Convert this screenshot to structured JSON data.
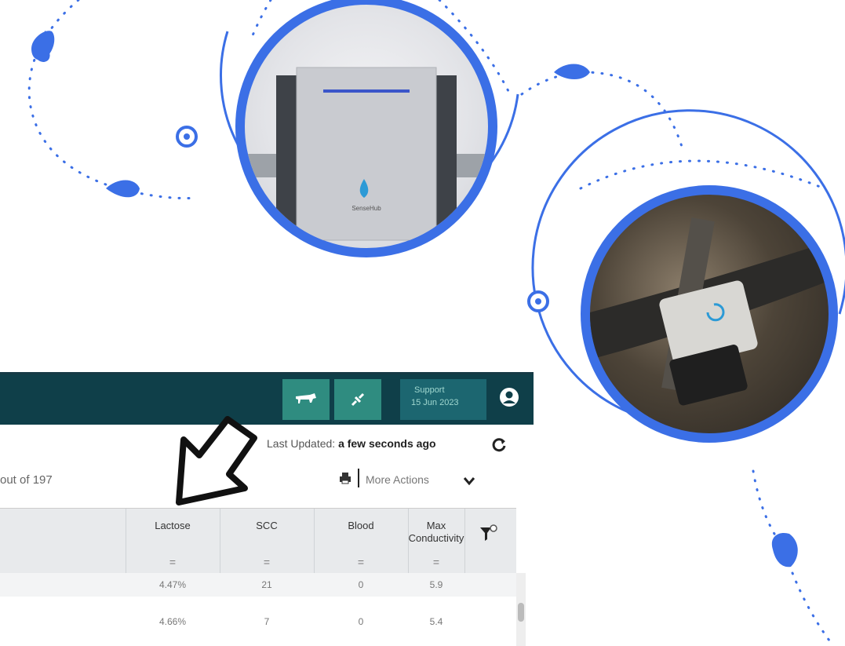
{
  "header": {
    "support_label": "Support",
    "date": "15 Jun 2023"
  },
  "status": {
    "last_updated_prefix": "Last Updated: ",
    "last_updated_value": "a few seconds ago"
  },
  "list": {
    "count_text": "out of 197",
    "more_actions": "More Actions"
  },
  "table": {
    "columns": [
      "Lactose",
      "SCC",
      "Blood",
      "Max Conductivity"
    ],
    "filter_symbol": "=",
    "rows": [
      [
        "4.47%",
        "21",
        "0",
        "5.9"
      ],
      [
        "4.66%",
        "7",
        "0",
        "5.4"
      ]
    ]
  },
  "device_labels": {
    "brand": "SenseHub",
    "brand_mark": "™"
  },
  "colors": {
    "accent": "#3b6fe6",
    "topbar": "#0f3f49",
    "teal_button": "#2f8c80"
  },
  "icons": [
    "cow-icon",
    "plug-icon",
    "user-icon",
    "refresh-icon",
    "print-icon",
    "chevron-down-icon",
    "filter-icon",
    "arrow-pointer-icon"
  ]
}
